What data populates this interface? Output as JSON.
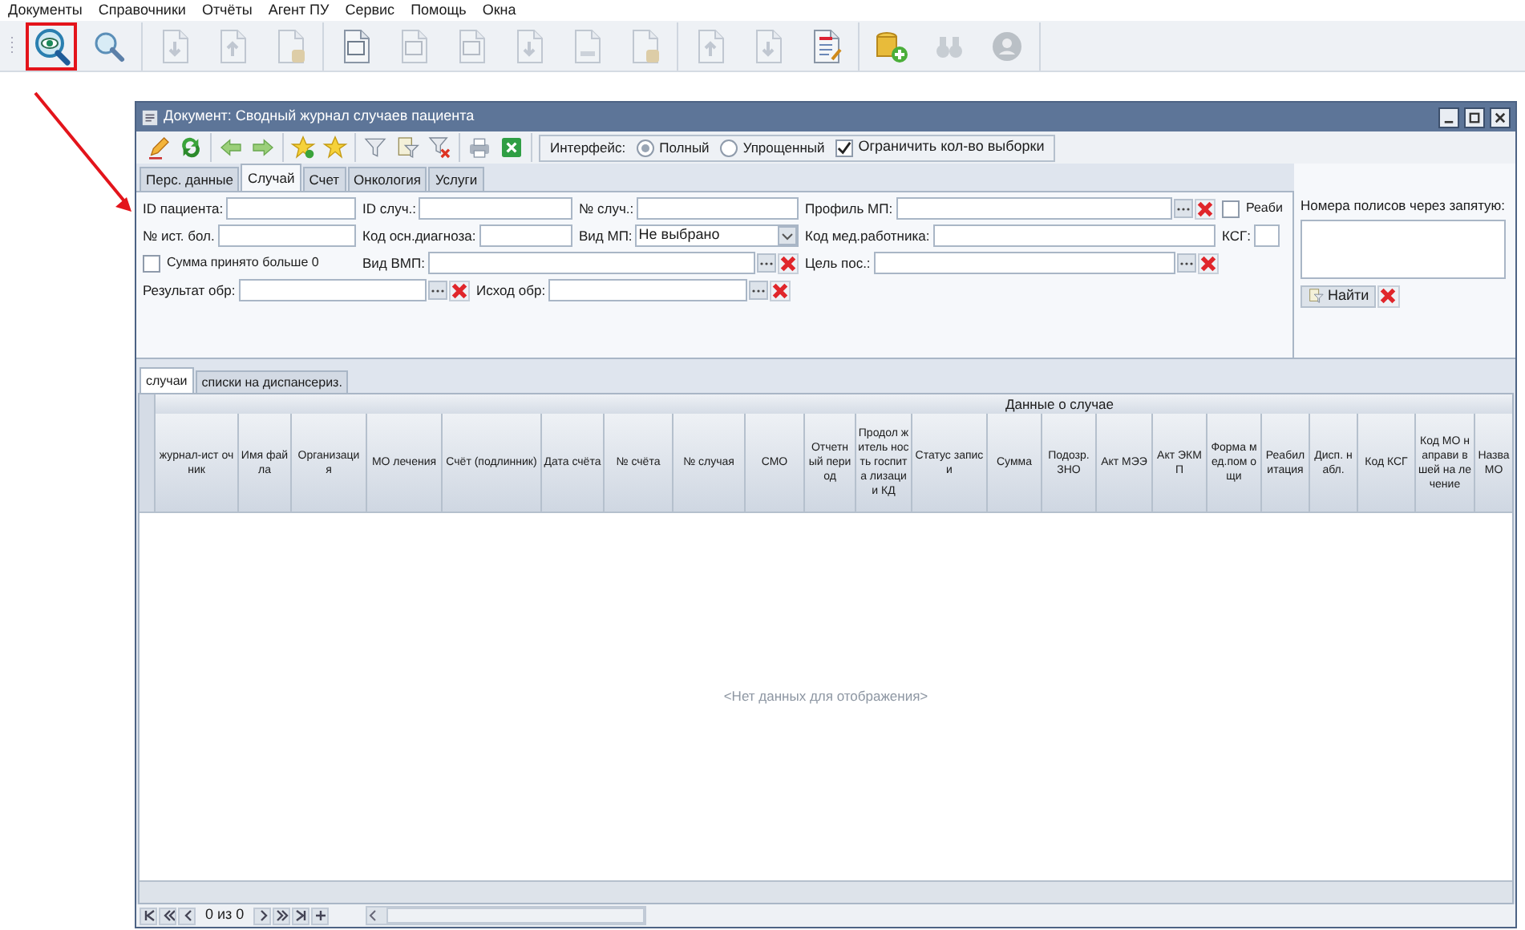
{
  "menu": [
    "Документы",
    "Справочники",
    "Отчёты",
    "Агент ПУ",
    "Сервис",
    "Помощь",
    "Окна"
  ],
  "main_toolbar": [
    [
      {
        "kind": "eye-search",
        "disabled": false,
        "highlighted": true
      },
      {
        "kind": "search",
        "disabled": false,
        "highlighted": false
      }
    ],
    [
      {
        "kind": "doc-down",
        "disabled": true,
        "highlighted": false
      },
      {
        "kind": "doc-up",
        "disabled": true,
        "highlighted": false
      },
      {
        "kind": "doc-coins",
        "disabled": true,
        "highlighted": false
      }
    ],
    [
      {
        "kind": "doc-label",
        "disabled": false,
        "highlighted": false
      },
      {
        "kind": "doc-label",
        "disabled": true,
        "highlighted": false
      },
      {
        "kind": "doc-label",
        "disabled": true,
        "highlighted": false
      },
      {
        "kind": "doc-down",
        "disabled": true,
        "highlighted": false
      },
      {
        "kind": "doc-plain",
        "disabled": true,
        "highlighted": false
      },
      {
        "kind": "doc-coins",
        "disabled": true,
        "highlighted": false
      }
    ],
    [
      {
        "kind": "doc-up",
        "disabled": true,
        "highlighted": false
      },
      {
        "kind": "doc-down",
        "disabled": true,
        "highlighted": false
      },
      {
        "kind": "doc-list",
        "disabled": false,
        "highlighted": false
      }
    ],
    [
      {
        "kind": "coins",
        "disabled": false,
        "highlighted": false
      },
      {
        "kind": "binoculars",
        "disabled": true,
        "highlighted": false
      },
      {
        "kind": "user",
        "disabled": true,
        "highlighted": false
      }
    ]
  ],
  "window": {
    "title": "Документ: Сводный журнал случаев пациента",
    "toolbar": [
      [
        {
          "kind": "pencil"
        },
        {
          "kind": "recycle"
        }
      ],
      [
        {
          "kind": "arrow-left"
        },
        {
          "kind": "arrow-right"
        }
      ],
      [
        {
          "kind": "star-add"
        },
        {
          "kind": "star"
        }
      ],
      [
        {
          "kind": "filter"
        },
        {
          "kind": "filter-doc"
        },
        {
          "kind": "filter-clear"
        }
      ],
      [
        {
          "kind": "printer"
        },
        {
          "kind": "excel"
        }
      ]
    ],
    "interface": {
      "label": "Интерфейс:",
      "options": [
        {
          "label": "Полный",
          "selected": true
        },
        {
          "label": "Упрощенный",
          "selected": false
        }
      ],
      "limit": {
        "label": "Ограничить кол-во выборки",
        "checked": true
      }
    },
    "tabs": [
      {
        "label": "Перс. данные",
        "selected": false
      },
      {
        "label": "Случай",
        "selected": true
      },
      {
        "label": "Счет",
        "selected": false
      },
      {
        "label": "Онкология",
        "selected": false
      },
      {
        "label": "Услуги",
        "selected": false
      }
    ],
    "form": [
      [
        {
          "kind": "text",
          "label": "ID пациента:"
        },
        {
          "kind": "text",
          "label": "ID случ.:"
        },
        {
          "kind": "text",
          "label": "№ случ.:"
        },
        {
          "kind": "lookup",
          "label": "Профиль МП:"
        },
        {
          "kind": "check",
          "label": "Реаби",
          "checked": false
        }
      ],
      [
        {
          "kind": "text",
          "label": "№ ист. бол."
        },
        {
          "kind": "text",
          "label": "Код осн.диагноза:"
        },
        {
          "kind": "combo",
          "label": "Вид МП:",
          "value": "Не выбрано"
        },
        {
          "kind": "text",
          "label": "Код мед.работника:"
        },
        {
          "kind": "text",
          "label": "КСГ:"
        }
      ],
      [
        {
          "kind": "check",
          "label": "Сумма принято больше 0",
          "checked": false
        },
        {
          "kind": "lookup",
          "label": "Вид ВМП:"
        },
        {
          "kind": "lookup",
          "label": "Цель пос.:"
        }
      ],
      [
        {
          "kind": "lookup",
          "label": "Результат обр:"
        },
        {
          "kind": "lookup",
          "label": "Исход обр:"
        }
      ]
    ],
    "policies": {
      "label": "Номера полисов через запятую:",
      "find": "Найти"
    },
    "grid_tabs": [
      {
        "label": "случаи",
        "selected": true
      },
      {
        "label": "списки на диспансериз.",
        "selected": false
      }
    ],
    "grid": {
      "group": "Данные о случае",
      "columns": [
        "журнал-ист очник",
        "Имя файла",
        "Организаци я",
        "МО лечения",
        "Счёт (подлинник)",
        "Дата счёта",
        "№ счёта",
        "№ случая",
        "СМО",
        "Отчетн ый период",
        "Продол житель ность госпита лизации КД",
        "Статус записи",
        "Сумма",
        "Подозр. ЗНО",
        "Акт МЭЭ",
        "Акт ЭКМП",
        "Форма мед.пом ощи",
        "Реабил итация",
        "Дисп. набл.",
        "Код КСГ",
        "Код МО направи вшей на лечение",
        "Назва МО"
      ],
      "empty": "<Нет данных для отображения>"
    },
    "navigator": {
      "position": "0 из 0"
    }
  }
}
